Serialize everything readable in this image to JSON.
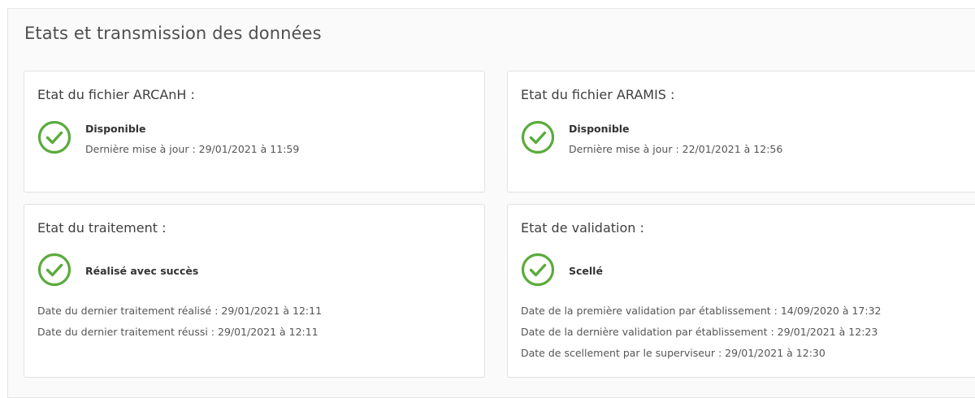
{
  "page": {
    "title": "Etats et transmission des données"
  },
  "icons": {
    "status_icon": "check-circle-icon",
    "status_color": "#5aab3c"
  },
  "cards": {
    "arcanh": {
      "title": "Etat du fichier ARCAnH :",
      "status": "Disponible",
      "update": "Dernière mise à jour : 29/01/2021 à 11:59"
    },
    "aramis": {
      "title": "Etat du fichier ARAMIS :",
      "status": "Disponible",
      "update": "Dernière mise à jour : 22/01/2021 à 12:56"
    },
    "traitement": {
      "title": "Etat du traitement :",
      "status": "Réalisé avec succès",
      "lines": [
        "Date du dernier traitement réalisé : 29/01/2021 à 12:11",
        "Date du dernier traitement réussi : 29/01/2021 à 12:11"
      ]
    },
    "validation": {
      "title": "Etat de validation :",
      "status": "Scellé",
      "lines": [
        "Date de la première validation par établissement : 14/09/2020 à 17:32",
        "Date de la dernière validation par établissement : 29/01/2021 à 12:23",
        "Date de scellement par le superviseur : 29/01/2021 à 12:30"
      ]
    }
  }
}
